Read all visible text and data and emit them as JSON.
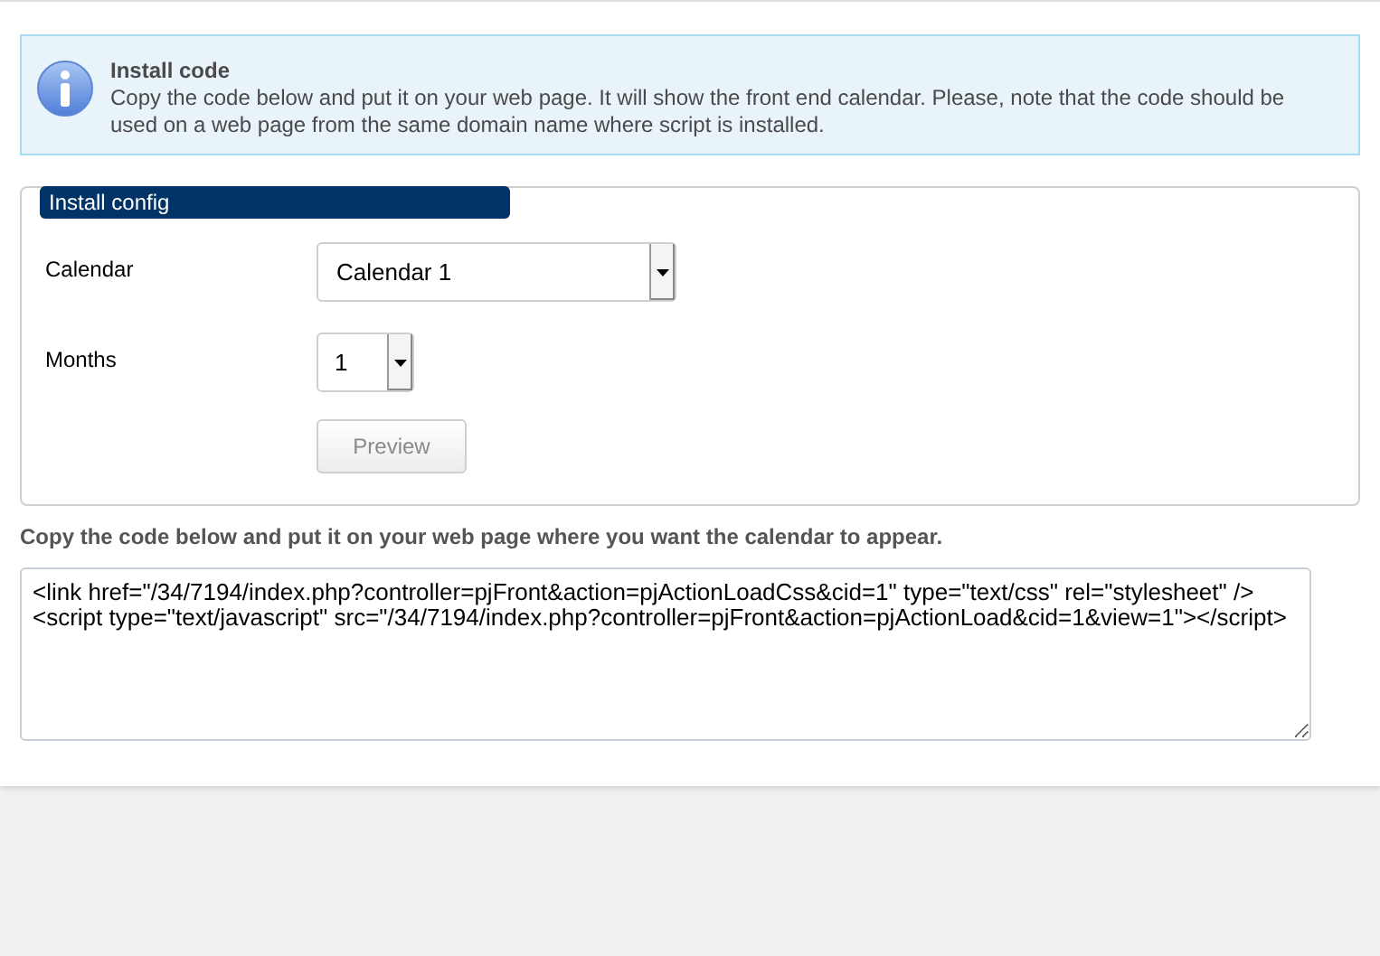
{
  "notice": {
    "title": "Install code",
    "text": "Copy the code below and put it on your web page. It will show the front end calendar. Please, note that the code should be used on a web page from the same domain name where script is installed."
  },
  "config": {
    "legend": "Install config",
    "fields": [
      {
        "label": "Calendar",
        "value": "Calendar 1",
        "kind": "wide"
      },
      {
        "label": "Months",
        "value": "1",
        "kind": "narrow"
      }
    ],
    "button": "Preview"
  },
  "instructions": "Copy the code below and put it on your web page where you want the calendar to appear.",
  "code": "<link href=\"/34/7194/index.php?controller=pjFront&action=pjActionLoadCss&cid=1\" type=\"text/css\" rel=\"stylesheet\" />\n<script type=\"text/javascript\" src=\"/34/7194/index.php?controller=pjFront&action=pjActionLoad&cid=1&view=1\"></script>"
}
